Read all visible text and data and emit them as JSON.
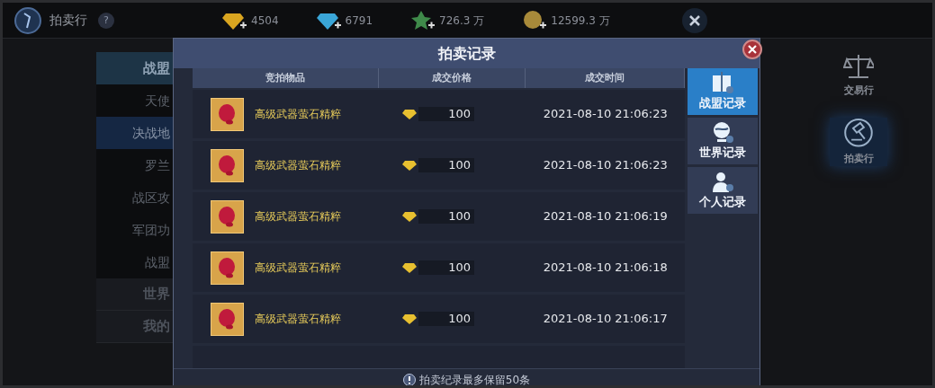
{
  "header": {
    "title": "拍卖行",
    "help": "?",
    "currencies": [
      {
        "kind": "gold-gem",
        "amount": "4504"
      },
      {
        "kind": "blue-gem",
        "amount": "6791"
      },
      {
        "kind": "green-crystal",
        "amount": "726.3 万"
      },
      {
        "kind": "coin",
        "amount": "12599.3 万"
      }
    ]
  },
  "side_menu": [
    {
      "label": "战盟",
      "selected": true,
      "items": [
        {
          "label": "天使",
          "selected": false
        },
        {
          "label": "决战地",
          "selected": true
        },
        {
          "label": "罗兰",
          "selected": false
        },
        {
          "label": "战区攻",
          "selected": false
        },
        {
          "label": "军团功",
          "selected": false
        },
        {
          "label": "战盟",
          "selected": false
        }
      ]
    },
    {
      "label": "世界",
      "selected": false
    },
    {
      "label": "我的",
      "selected": false
    }
  ],
  "right_nav": [
    {
      "kind": "scales",
      "label": "交易行",
      "selected": false
    },
    {
      "kind": "gavel",
      "label": "拍卖行",
      "selected": true
    }
  ],
  "dialog": {
    "title": "拍卖记录",
    "columns": [
      "竞拍物品",
      "成交价格",
      "成交时间"
    ],
    "rows": [
      {
        "item": "高级武器萤石精粹",
        "price": "100",
        "time": "2021-08-10 21:06:23"
      },
      {
        "item": "高级武器萤石精粹",
        "price": "100",
        "time": "2021-08-10 21:06:23"
      },
      {
        "item": "高级武器萤石精粹",
        "price": "100",
        "time": "2021-08-10 21:06:19"
      },
      {
        "item": "高级武器萤石精粹",
        "price": "100",
        "time": "2021-08-10 21:06:18"
      },
      {
        "item": "高级武器萤石精粹",
        "price": "100",
        "time": "2021-08-10 21:06:17"
      }
    ],
    "tabs": [
      {
        "kind": "alliance",
        "label": "战盟记录",
        "selected": true
      },
      {
        "kind": "world",
        "label": "世界记录",
        "selected": false
      },
      {
        "kind": "personal",
        "label": "个人记录",
        "selected": false
      }
    ],
    "note": "拍卖纪录最多保留50条"
  }
}
